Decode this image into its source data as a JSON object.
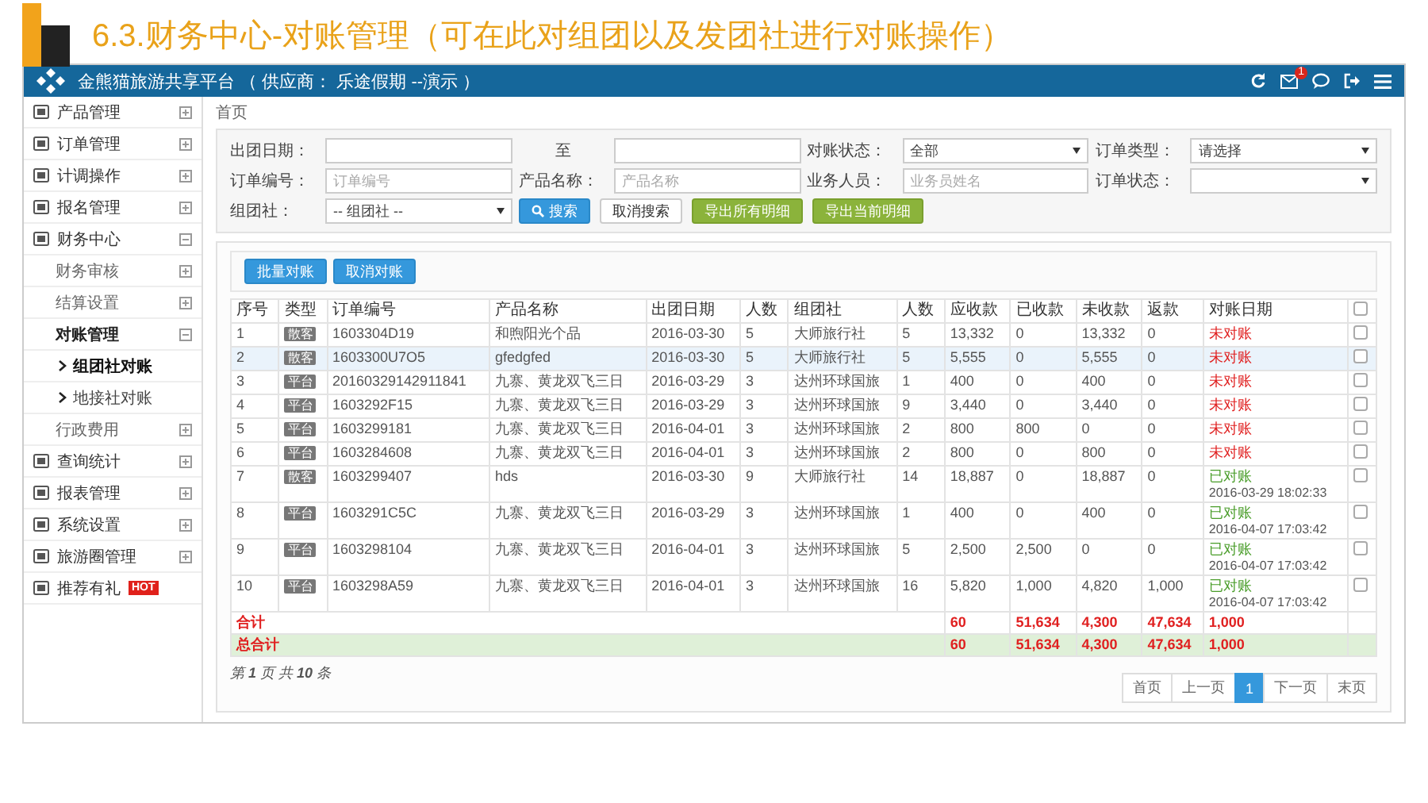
{
  "slide_title": "6.3.财务中心-对账管理（可在此对组团以及发团社进行对账操作）",
  "app": {
    "title": "金熊猫旅游共享平台 （ 供应商： 乐途假期 --演示 ）",
    "mail_badge": "1"
  },
  "sidebar": {
    "items": [
      {
        "label": "产品管理",
        "expanded": false
      },
      {
        "label": "订单管理",
        "expanded": false
      },
      {
        "label": "计调操作",
        "expanded": false
      },
      {
        "label": "报名管理",
        "expanded": false
      },
      {
        "label": "财务中心",
        "expanded": true,
        "children": [
          {
            "label": "财务审核",
            "expanded": false
          },
          {
            "label": "结算设置",
            "expanded": false
          },
          {
            "label": "对账管理",
            "expanded": true,
            "children": [
              {
                "label": "组团社对账",
                "selected": true
              },
              {
                "label": "地接社对账",
                "selected": false
              }
            ]
          },
          {
            "label": "行政费用",
            "expanded": false
          }
        ]
      },
      {
        "label": "查询统计",
        "expanded": false
      },
      {
        "label": "报表管理",
        "expanded": false
      },
      {
        "label": "系统设置",
        "expanded": false
      },
      {
        "label": "旅游圈管理",
        "expanded": false
      },
      {
        "label": "推荐有礼",
        "badge": "HOT"
      }
    ]
  },
  "breadcrumb": "首页",
  "filters": [
    {
      "label": "出团日期：",
      "kind": "text"
    },
    {
      "label": "至",
      "kind": "text"
    },
    {
      "label": "对账状态：",
      "kind": "select",
      "value": "全部"
    },
    {
      "label": "订单类型：",
      "kind": "select",
      "value": "请选择"
    },
    {
      "label": "订单编号：",
      "kind": "text",
      "placeholder": "订单编号"
    },
    {
      "label": "产品名称：",
      "kind": "text",
      "placeholder": "产品名称"
    },
    {
      "label": "业务人员：",
      "kind": "text",
      "placeholder": "业务员姓名"
    },
    {
      "label": "订单状态：",
      "kind": "select"
    },
    {
      "label": "组团社：",
      "kind": "select",
      "value": "-- 组团社 --"
    }
  ],
  "filter_buttons": [
    {
      "label": "搜索",
      "kind": "primary"
    },
    {
      "label": "取消搜索",
      "kind": "default"
    },
    {
      "label": "导出所有明细",
      "kind": "success"
    },
    {
      "label": "导出当前明细",
      "kind": "success"
    }
  ],
  "batch_buttons": [
    "批量对账",
    "取消对账"
  ],
  "table": {
    "columns": [
      "序号",
      "类型",
      "订单编号",
      "产品名称",
      "出团日期",
      "人数",
      "组团社",
      "人数",
      "应收款",
      "已收款",
      "未收款",
      "返款",
      "对账日期"
    ],
    "all_checked": false,
    "rows": [
      {
        "no": "1",
        "type": "散客",
        "order_no": "1603304D19",
        "product": "和煦阳光个品",
        "date": "2016-03-30",
        "people": "5",
        "agency": "大师旅行社",
        "count": "5",
        "receivable": "13,332",
        "received": "0",
        "unreceived": "13,332",
        "refund": "0",
        "status": "未对账",
        "reconciled": false,
        "checked": false,
        "selected": false
      },
      {
        "no": "2",
        "type": "散客",
        "order_no": "1603300U7O5",
        "product": "gfedgfed",
        "date": "2016-03-30",
        "people": "5",
        "agency": "大师旅行社",
        "count": "5",
        "receivable": "5,555",
        "received": "0",
        "unreceived": "5,555",
        "refund": "0",
        "status": "未对账",
        "reconciled": false,
        "checked": false,
        "selected": true
      },
      {
        "no": "3",
        "type": "平台",
        "order_no": "20160329142911841",
        "product": "九寨、黄龙双飞三日",
        "date": "2016-03-29",
        "people": "3",
        "agency": "达州环球国旅",
        "count": "1",
        "receivable": "400",
        "received": "0",
        "unreceived": "400",
        "refund": "0",
        "status": "未对账",
        "reconciled": false,
        "checked": false,
        "selected": false
      },
      {
        "no": "4",
        "type": "平台",
        "order_no": "1603292F15",
        "product": "九寨、黄龙双飞三日",
        "date": "2016-03-29",
        "people": "3",
        "agency": "达州环球国旅",
        "count": "9",
        "receivable": "3,440",
        "received": "0",
        "unreceived": "3,440",
        "refund": "0",
        "status": "未对账",
        "reconciled": false,
        "checked": false,
        "selected": false
      },
      {
        "no": "5",
        "type": "平台",
        "order_no": "1603299181",
        "product": "九寨、黄龙双飞三日",
        "date": "2016-04-01",
        "people": "3",
        "agency": "达州环球国旅",
        "count": "2",
        "receivable": "800",
        "received": "800",
        "unreceived": "0",
        "refund": "0",
        "status": "未对账",
        "reconciled": false,
        "checked": false,
        "selected": false
      },
      {
        "no": "6",
        "type": "平台",
        "order_no": "1603284608",
        "product": "九寨、黄龙双飞三日",
        "date": "2016-04-01",
        "people": "3",
        "agency": "达州环球国旅",
        "count": "2",
        "receivable": "800",
        "received": "0",
        "unreceived": "800",
        "refund": "0",
        "status": "未对账",
        "reconciled": false,
        "checked": false,
        "selected": false
      },
      {
        "no": "7",
        "type": "散客",
        "order_no": "1603299407",
        "product": "hds",
        "date": "2016-03-30",
        "people": "9",
        "agency": "大师旅行社",
        "count": "14",
        "receivable": "18,887",
        "received": "0",
        "unreceived": "18,887",
        "refund": "0",
        "status": "已对账",
        "time": "2016-03-29 18:02:33",
        "reconciled": true,
        "checked": false,
        "selected": false
      },
      {
        "no": "8",
        "type": "平台",
        "order_no": "1603291C5C",
        "product": "九寨、黄龙双飞三日",
        "date": "2016-03-29",
        "people": "3",
        "agency": "达州环球国旅",
        "count": "1",
        "receivable": "400",
        "received": "0",
        "unreceived": "400",
        "refund": "0",
        "status": "已对账",
        "time": "2016-04-07 17:03:42",
        "reconciled": true,
        "checked": false,
        "selected": false
      },
      {
        "no": "9",
        "type": "平台",
        "order_no": "1603298104",
        "product": "九寨、黄龙双飞三日",
        "date": "2016-04-01",
        "people": "3",
        "agency": "达州环球国旅",
        "count": "5",
        "receivable": "2,500",
        "received": "2,500",
        "unreceived": "0",
        "refund": "0",
        "status": "已对账",
        "time": "2016-04-07 17:03:42",
        "reconciled": true,
        "checked": false,
        "selected": false
      },
      {
        "no": "10",
        "type": "平台",
        "order_no": "1603298A59",
        "product": "九寨、黄龙双飞三日",
        "date": "2016-04-01",
        "people": "3",
        "agency": "达州环球国旅",
        "count": "16",
        "receivable": "5,820",
        "received": "1,000",
        "unreceived": "4,820",
        "refund": "1,000",
        "status": "已对账",
        "time": "2016-04-07 17:03:42",
        "reconciled": true,
        "checked": false,
        "selected": false
      }
    ],
    "totals": [
      {
        "label": "合计",
        "values": [
          "60",
          "51,634",
          "4,300",
          "47,634",
          "1,000"
        ],
        "highlighted": false
      },
      {
        "label": "总合计",
        "values": [
          "60",
          "51,634",
          "4,300",
          "47,634",
          "1,000"
        ],
        "highlighted": true
      }
    ]
  },
  "pagination": {
    "summary": "第 **1** 页 共 **10** 条",
    "pages": [
      {
        "label": "首页",
        "selected": false
      },
      {
        "label": "上一页",
        "selected": false
      },
      {
        "label": "1",
        "selected": true
      },
      {
        "label": "下一页",
        "selected": false
      },
      {
        "label": "末页",
        "selected": false
      }
    ]
  }
}
